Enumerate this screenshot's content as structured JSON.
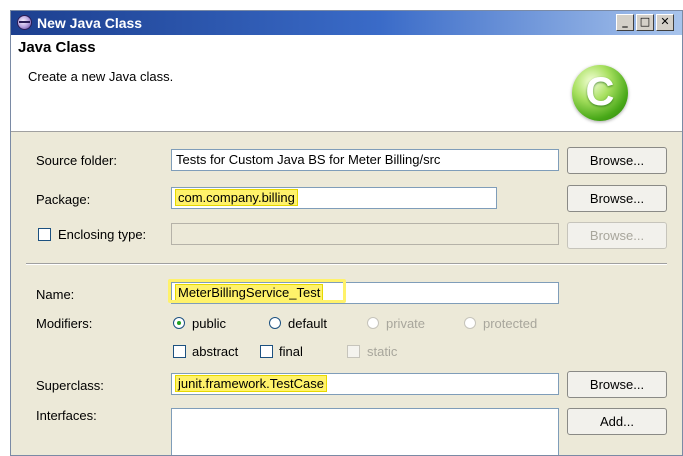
{
  "window": {
    "title": "New Java Class",
    "controls": {
      "minimize": "_",
      "maximize": "□",
      "close": "✕"
    }
  },
  "header": {
    "title": "Java Class",
    "description": "Create a new Java class.",
    "badge_letter": "C"
  },
  "form": {
    "source_folder": {
      "label": "Source folder:",
      "value": "Tests for Custom Java BS for Meter Billing/src",
      "browse": "Browse..."
    },
    "package": {
      "label": "Package:",
      "value": "com.company.billing",
      "browse": "Browse..."
    },
    "enclosing_type": {
      "label": "Enclosing type:",
      "checked": false,
      "value": "",
      "browse": "Browse..."
    },
    "name": {
      "label": "Name:",
      "value": "MeterBillingService_Test"
    },
    "modifiers": {
      "label": "Modifiers:",
      "access": [
        {
          "label": "public",
          "selected": true,
          "enabled": true
        },
        {
          "label": "default",
          "selected": false,
          "enabled": true
        },
        {
          "label": "private",
          "selected": false,
          "enabled": false
        },
        {
          "label": "protected",
          "selected": false,
          "enabled": false
        }
      ],
      "flags": [
        {
          "label": "abstract",
          "checked": false,
          "enabled": true
        },
        {
          "label": "final",
          "checked": false,
          "enabled": true
        },
        {
          "label": "static",
          "checked": false,
          "enabled": false
        }
      ]
    },
    "superclass": {
      "label": "Superclass:",
      "value": "junit.framework.TestCase",
      "browse": "Browse..."
    },
    "interfaces": {
      "label": "Interfaces:",
      "add": "Add..."
    }
  },
  "colors": {
    "highlight": "#fff26a",
    "titlebar_start": "#1c3f8f",
    "titlebar_end": "#a8c4ec"
  }
}
